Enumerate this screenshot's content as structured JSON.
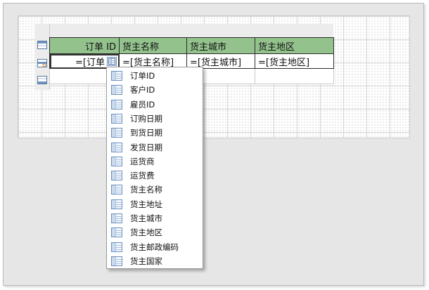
{
  "table": {
    "headers": [
      "订单 ID",
      "货主名称",
      "货主城市",
      "货主地区"
    ],
    "data_cells": [
      "=[订单",
      "=[货主名称]",
      "=[货主城市]",
      "=[货主地区]"
    ]
  },
  "field_menu": {
    "items": [
      "订单ID",
      "客户ID",
      "雇员ID",
      "订购日期",
      "到货日期",
      "发货日期",
      "运货商",
      "运货费",
      "货主名称",
      "货主地址",
      "货主城市",
      "货主地区",
      "货主邮政编码",
      "货主国家"
    ]
  },
  "colors": {
    "header_fill": "#93c28d",
    "menu_border": "#9a9a9a"
  },
  "icons": [
    "table-header-row-icon",
    "table-detail-row-icon",
    "table-footer-row-icon",
    "field-list-icon"
  ]
}
